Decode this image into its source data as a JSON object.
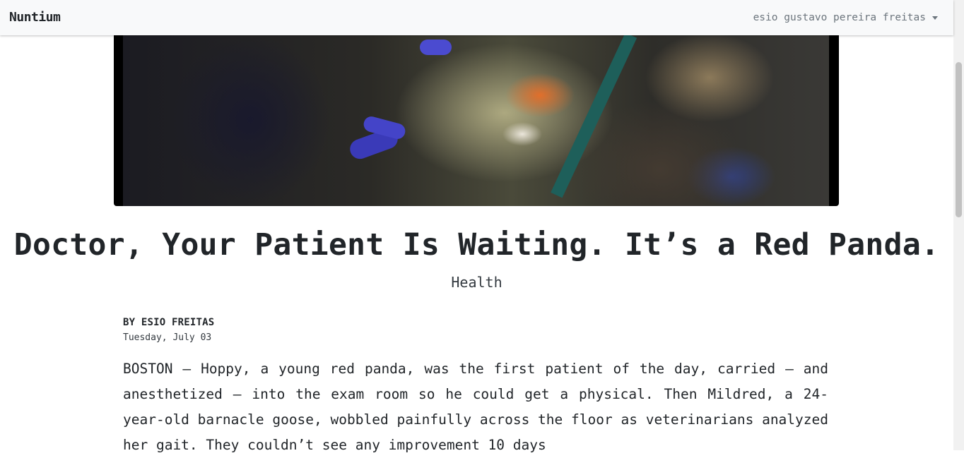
{
  "navbar": {
    "brand": "Nuntium",
    "user_name": "esio gustavo pereira freitas"
  },
  "icons": {
    "user_menu_caret": "caret-down-icon"
  },
  "article": {
    "headline": "Doctor, Your Patient Is Waiting. It’s a Red Panda.",
    "category": "Health",
    "byline": "BY ESIO FREITAS",
    "date": "Tuesday, July 03",
    "body": "BOSTON — Hoppy, a young red panda, was the first patient of the day, carried — and anesthetized — into the exam room so he could get a physical. Then Mildred, a 24-year-old barnacle goose, wobbled painfully across the floor as veterinarians analyzed her gait. They couldn’t see any improvement 10 days"
  }
}
